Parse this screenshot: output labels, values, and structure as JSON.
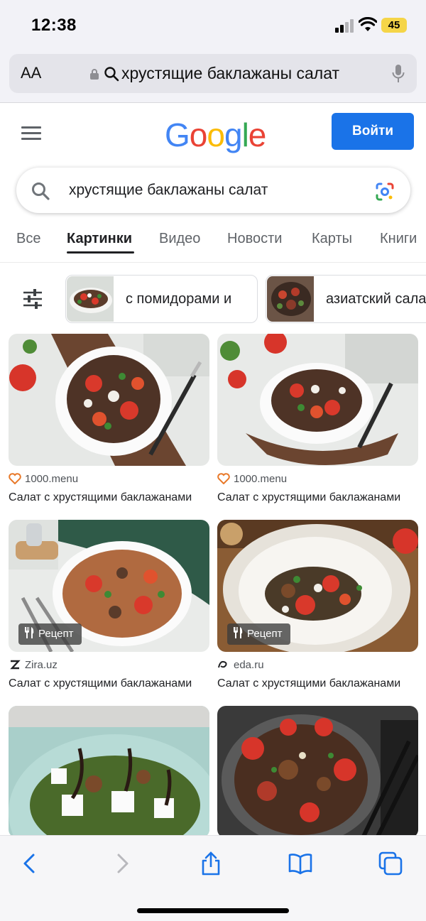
{
  "status": {
    "time": "12:38",
    "battery": "45"
  },
  "browser": {
    "text_size_label": "AA",
    "url_text": "хрустящие баклажаны салат"
  },
  "google": {
    "logo_letters": [
      "G",
      "o",
      "o",
      "g",
      "l",
      "e"
    ],
    "sign_in": "Войти",
    "query": "хрустящие баклажаны салат"
  },
  "tabs": [
    "Все",
    "Картинки",
    "Видео",
    "Новости",
    "Карты",
    "Книги"
  ],
  "active_tab": "Картинки",
  "chips": [
    "с помидорами и",
    "азиатский салат"
  ],
  "results": [
    {
      "source": "1000.menu",
      "title": "Салат с хрустящими баклажанами",
      "badge": ""
    },
    {
      "source": "1000.menu",
      "title": "Салат с хрустящими баклажанами",
      "badge": ""
    },
    {
      "source": "Zira.uz",
      "title": "Салат с хрустящими баклажанами",
      "badge": "Рецепт"
    },
    {
      "source": "eda.ru",
      "title": "Салат с хрустящими баклажанами",
      "badge": "Рецепт"
    },
    {
      "source": "",
      "title": "",
      "badge": ""
    },
    {
      "source": "",
      "title": "",
      "badge": ""
    }
  ],
  "favicons": {
    "1000.menu": "heart-icon",
    "Zira.uz": "z-logo-icon",
    "eda.ru": "eda-logo-icon"
  },
  "colors": {
    "accent": "#1a73e8",
    "safari_blue": "#1a73e8"
  }
}
